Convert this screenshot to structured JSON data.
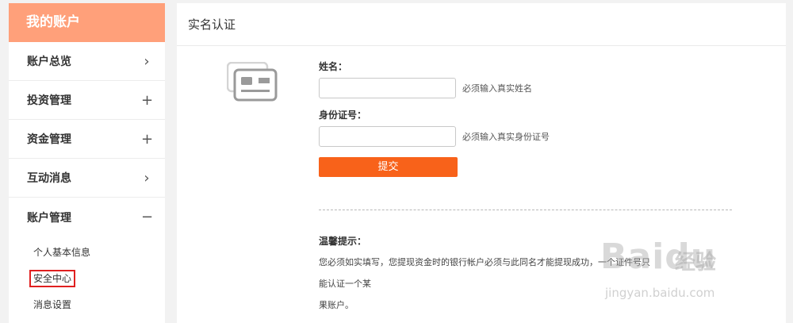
{
  "sidebar": {
    "title": "我的账户",
    "groups": [
      {
        "label": "账户总览",
        "toggle": "›"
      },
      {
        "label": "投资管理",
        "toggle": "+"
      },
      {
        "label": "资金管理",
        "toggle": "+"
      },
      {
        "label": "互动消息",
        "toggle": "›"
      },
      {
        "label": "账户管理",
        "toggle": "−"
      }
    ],
    "sub_items": [
      {
        "label": "个人基本信息"
      },
      {
        "label": "安全中心"
      },
      {
        "label": "消息设置"
      }
    ]
  },
  "main": {
    "title": "实名认证",
    "icon": "id-card-icon",
    "form": {
      "name_label": "姓名：",
      "name_value": "",
      "name_hint": "必须输入真实姓名",
      "id_label": "身份证号：",
      "id_value": "",
      "id_hint": "必须输入真实身份证号",
      "submit_label": "提交"
    },
    "tips": {
      "title": "温馨提示：",
      "line1": "您必须如实填写，您提现资金时的银行帐户必须与此同名才能提现成功，一个证件号只能认证一个某",
      "line2": "果账户。"
    }
  },
  "watermark": {
    "brand": "Baidu",
    "sub": "经验",
    "url": "jingyan.baidu.com"
  },
  "colors": {
    "sidebar_header": "#ffa07a",
    "submit": "#f8621a",
    "active_outline": "#e02020"
  }
}
